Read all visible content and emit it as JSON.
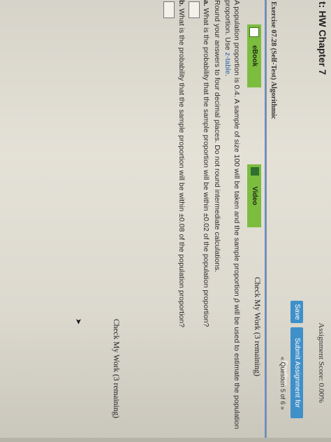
{
  "header": {
    "title": "t: HW Chapter 7",
    "score_label": "Assignment Score: 0.00%"
  },
  "toolbar": {
    "save_label": "Save",
    "submit_label": "Submit Assignment for Grading"
  },
  "question_nav": {
    "text": "« Question 5 of 6 »"
  },
  "exercise": {
    "title": "Exercise 07.28 (Self-Test) Algorithmic"
  },
  "media": {
    "ebook_label": "eBook",
    "video_label": "Video"
  },
  "check": {
    "top_label": "Check My Work (3 remaining)",
    "bottom_label": "Check My Work (3 remaining)"
  },
  "problem": {
    "intro_line1_pre": "A population proportion is 0.4. A sample of size 100 will be taken and the sample proportion ",
    "p_hat": "p̄",
    "intro_line1_post": " will be used to estimate the population",
    "intro_line2_pre": "proportion. Use ",
    "z_table_link": "z-table",
    "intro_line2_post": ".",
    "rounding": "Round your answers to four decimal places. Do not round intermediate calculations.",
    "part_a_letter": "a.",
    "part_a_text": " What is the probability that the sample proportion will be within ±0.02 of the population proportion?",
    "part_b_letter": "b.",
    "part_b_text": " What is the probability that the sample proportion will be within ±0.08 of the population proportion?"
  },
  "colors": {
    "button_blue": "#3f8fc8",
    "media_green": "#7cbd3f",
    "link_blue": "#2d62a6",
    "rule_blue": "#6b8fbf"
  },
  "icons": {
    "ebook": "book-icon",
    "video": "video-icon",
    "cursor": "mouse-cursor-icon"
  },
  "answers": {
    "a": "",
    "b": ""
  }
}
